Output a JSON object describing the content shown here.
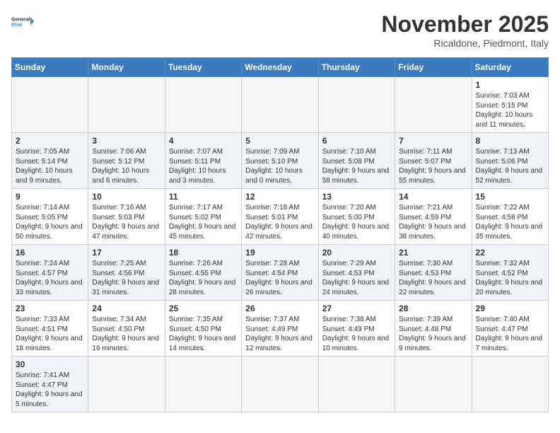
{
  "header": {
    "logo_general": "General",
    "logo_blue": "Blue",
    "month_title": "November 2025",
    "subtitle": "Ricaldone, Piedmont, Italy"
  },
  "weekdays": [
    "Sunday",
    "Monday",
    "Tuesday",
    "Wednesday",
    "Thursday",
    "Friday",
    "Saturday"
  ],
  "weeks": [
    [
      {
        "day": "",
        "info": ""
      },
      {
        "day": "",
        "info": ""
      },
      {
        "day": "",
        "info": ""
      },
      {
        "day": "",
        "info": ""
      },
      {
        "day": "",
        "info": ""
      },
      {
        "day": "",
        "info": ""
      },
      {
        "day": "1",
        "info": "Sunrise: 7:03 AM\nSunset: 5:15 PM\nDaylight: 10 hours\nand 11 minutes."
      }
    ],
    [
      {
        "day": "2",
        "info": "Sunrise: 7:05 AM\nSunset: 5:14 PM\nDaylight: 10 hours\nand 9 minutes."
      },
      {
        "day": "3",
        "info": "Sunrise: 7:06 AM\nSunset: 5:12 PM\nDaylight: 10 hours\nand 6 minutes."
      },
      {
        "day": "4",
        "info": "Sunrise: 7:07 AM\nSunset: 5:11 PM\nDaylight: 10 hours\nand 3 minutes."
      },
      {
        "day": "5",
        "info": "Sunrise: 7:09 AM\nSunset: 5:10 PM\nDaylight: 10 hours\nand 0 minutes."
      },
      {
        "day": "6",
        "info": "Sunrise: 7:10 AM\nSunset: 5:08 PM\nDaylight: 9 hours\nand 58 minutes."
      },
      {
        "day": "7",
        "info": "Sunrise: 7:11 AM\nSunset: 5:07 PM\nDaylight: 9 hours\nand 55 minutes."
      },
      {
        "day": "8",
        "info": "Sunrise: 7:13 AM\nSunset: 5:06 PM\nDaylight: 9 hours\nand 52 minutes."
      }
    ],
    [
      {
        "day": "9",
        "info": "Sunrise: 7:14 AM\nSunset: 5:05 PM\nDaylight: 9 hours\nand 50 minutes."
      },
      {
        "day": "10",
        "info": "Sunrise: 7:16 AM\nSunset: 5:03 PM\nDaylight: 9 hours\nand 47 minutes."
      },
      {
        "day": "11",
        "info": "Sunrise: 7:17 AM\nSunset: 5:02 PM\nDaylight: 9 hours\nand 45 minutes."
      },
      {
        "day": "12",
        "info": "Sunrise: 7:18 AM\nSunset: 5:01 PM\nDaylight: 9 hours\nand 42 minutes."
      },
      {
        "day": "13",
        "info": "Sunrise: 7:20 AM\nSunset: 5:00 PM\nDaylight: 9 hours\nand 40 minutes."
      },
      {
        "day": "14",
        "info": "Sunrise: 7:21 AM\nSunset: 4:59 PM\nDaylight: 9 hours\nand 38 minutes."
      },
      {
        "day": "15",
        "info": "Sunrise: 7:22 AM\nSunset: 4:58 PM\nDaylight: 9 hours\nand 35 minutes."
      }
    ],
    [
      {
        "day": "16",
        "info": "Sunrise: 7:24 AM\nSunset: 4:57 PM\nDaylight: 9 hours\nand 33 minutes."
      },
      {
        "day": "17",
        "info": "Sunrise: 7:25 AM\nSunset: 4:56 PM\nDaylight: 9 hours\nand 31 minutes."
      },
      {
        "day": "18",
        "info": "Sunrise: 7:26 AM\nSunset: 4:55 PM\nDaylight: 9 hours\nand 28 minutes."
      },
      {
        "day": "19",
        "info": "Sunrise: 7:28 AM\nSunset: 4:54 PM\nDaylight: 9 hours\nand 26 minutes."
      },
      {
        "day": "20",
        "info": "Sunrise: 7:29 AM\nSunset: 4:53 PM\nDaylight: 9 hours\nand 24 minutes."
      },
      {
        "day": "21",
        "info": "Sunrise: 7:30 AM\nSunset: 4:53 PM\nDaylight: 9 hours\nand 22 minutes."
      },
      {
        "day": "22",
        "info": "Sunrise: 7:32 AM\nSunset: 4:52 PM\nDaylight: 9 hours\nand 20 minutes."
      }
    ],
    [
      {
        "day": "23",
        "info": "Sunrise: 7:33 AM\nSunset: 4:51 PM\nDaylight: 9 hours\nand 18 minutes."
      },
      {
        "day": "24",
        "info": "Sunrise: 7:34 AM\nSunset: 4:50 PM\nDaylight: 9 hours\nand 16 minutes."
      },
      {
        "day": "25",
        "info": "Sunrise: 7:35 AM\nSunset: 4:50 PM\nDaylight: 9 hours\nand 14 minutes."
      },
      {
        "day": "26",
        "info": "Sunrise: 7:37 AM\nSunset: 4:49 PM\nDaylight: 9 hours\nand 12 minutes."
      },
      {
        "day": "27",
        "info": "Sunrise: 7:38 AM\nSunset: 4:49 PM\nDaylight: 9 hours\nand 10 minutes."
      },
      {
        "day": "28",
        "info": "Sunrise: 7:39 AM\nSunset: 4:48 PM\nDaylight: 9 hours\nand 9 minutes."
      },
      {
        "day": "29",
        "info": "Sunrise: 7:40 AM\nSunset: 4:47 PM\nDaylight: 9 hours\nand 7 minutes."
      }
    ],
    [
      {
        "day": "30",
        "info": "Sunrise: 7:41 AM\nSunset: 4:47 PM\nDaylight: 9 hours\nand 5 minutes."
      },
      {
        "day": "",
        "info": ""
      },
      {
        "day": "",
        "info": ""
      },
      {
        "day": "",
        "info": ""
      },
      {
        "day": "",
        "info": ""
      },
      {
        "day": "",
        "info": ""
      },
      {
        "day": "",
        "info": ""
      }
    ]
  ]
}
